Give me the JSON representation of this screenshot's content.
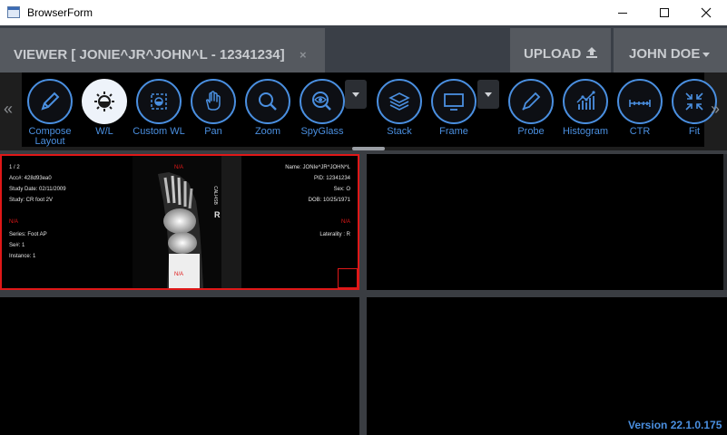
{
  "window": {
    "title": "BrowserForm"
  },
  "header": {
    "viewer_tab": "VIEWER [ JONIE^JR^JOHN^L - 12341234]",
    "tab_close": "×",
    "upload_label": "UPLOAD",
    "user_label": "JOHN DOE"
  },
  "toolbar": {
    "scroll_left": "«",
    "scroll_right": "»",
    "tools": [
      {
        "label": "Compose Layout",
        "icon": "pencil-icon"
      },
      {
        "label": "W/L",
        "icon": "window-level-icon",
        "active": true
      },
      {
        "label": "Custom WL",
        "icon": "custom-wl-icon"
      },
      {
        "label": "Pan",
        "icon": "hand-icon"
      },
      {
        "label": "Zoom",
        "icon": "magnifier-icon"
      },
      {
        "label": "SpyGlass",
        "icon": "spyglass-icon"
      },
      {
        "label": "Stack",
        "icon": "stack-icon"
      },
      {
        "label": "Frame",
        "icon": "frame-icon"
      },
      {
        "label": "Probe",
        "icon": "probe-icon"
      },
      {
        "label": "Histogram",
        "icon": "histogram-icon"
      },
      {
        "label": "CTR",
        "icon": "ruler-icon"
      },
      {
        "label": "Fit",
        "icon": "fit-icon"
      }
    ]
  },
  "viewport": {
    "left_top": [
      "1 / 2",
      "Acc#: 428d93ea0",
      "Study Date: 02/11/2009",
      "Study: CR foot 2V"
    ],
    "left_na": "N/A",
    "left_bottom": [
      "Series: Foot AP",
      "Se#: 1",
      "Instance: 1"
    ],
    "right_top": [
      "Name: JONIe^JR^JOHN^L",
      "PID: 12341234",
      "Sex: O",
      "DOB: 10/25/1971"
    ],
    "right_na": "N/A",
    "laterality": "Laterality : R",
    "top_na": "N/A",
    "bottom_na": "N/A",
    "marker_r": "R",
    "marker_text": "CALI4SB"
  },
  "footer": {
    "version": "Version 22.1.0.175"
  },
  "colors": {
    "accent": "#4a8fe0",
    "selection": "#e01818"
  }
}
